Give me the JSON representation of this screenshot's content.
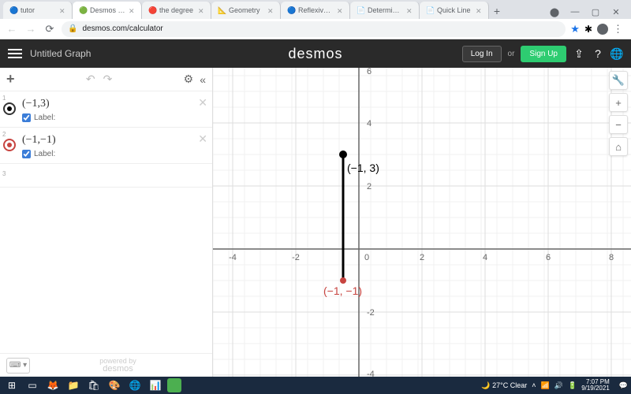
{
  "browser": {
    "tabs": [
      {
        "label": "tutor",
        "icon": "N"
      },
      {
        "label": "Desmos | G",
        "icon": "D",
        "active": true
      },
      {
        "label": "the degree",
        "icon": "G"
      },
      {
        "label": "Geometry",
        "icon": ""
      },
      {
        "label": "Reflexive, S",
        "icon": "O"
      },
      {
        "label": "Determining",
        "icon": "≡"
      },
      {
        "label": "Quick Line",
        "icon": "≡"
      }
    ],
    "url": "desmos.com/calculator",
    "window_controls": {
      "record": "⬤",
      "min": "—",
      "max": "▢",
      "close": "✕"
    }
  },
  "header": {
    "title": "Untitled Graph",
    "logo": "desmos",
    "login": "Log In",
    "or": "or",
    "signup": "Sign Up"
  },
  "sidebar": {
    "expressions": [
      {
        "num": "1",
        "text": "(−1,3)",
        "color": "black",
        "label": "Label:"
      },
      {
        "num": "2",
        "text": "(−1,−1)",
        "color": "red",
        "label": "Label:"
      }
    ],
    "empty_num": "3",
    "powered_top": "powered by",
    "powered": "desmos"
  },
  "graph": {
    "point1_label": "(−1, 3)",
    "point2_label": "(−1, −1)",
    "x_ticks": [
      "-4",
      "-2",
      "0",
      "2",
      "4",
      "6",
      "8"
    ],
    "y_ticks": [
      "6",
      "4",
      "2",
      "-2",
      "-4"
    ]
  },
  "taskbar": {
    "weather": "27°C  Clear",
    "time": "7:07 PM",
    "date": "9/19/2021"
  },
  "chart_data": {
    "type": "scatter",
    "points": [
      {
        "x": -1,
        "y": 3,
        "color": "#000000",
        "label": "(−1, 3)"
      },
      {
        "x": -1,
        "y": -1,
        "color": "#c74440",
        "label": "(−1, −1)"
      }
    ],
    "segments": [
      {
        "from": [
          -1,
          3
        ],
        "to": [
          -1,
          -1
        ],
        "color": "#000000"
      }
    ],
    "xlim": [
      -5,
      9
    ],
    "ylim": [
      -5,
      6.5
    ],
    "grid": true,
    "x_ticks": [
      -4,
      -2,
      0,
      2,
      4,
      6,
      8
    ],
    "y_ticks": [
      -4,
      -2,
      2,
      4,
      6
    ]
  }
}
